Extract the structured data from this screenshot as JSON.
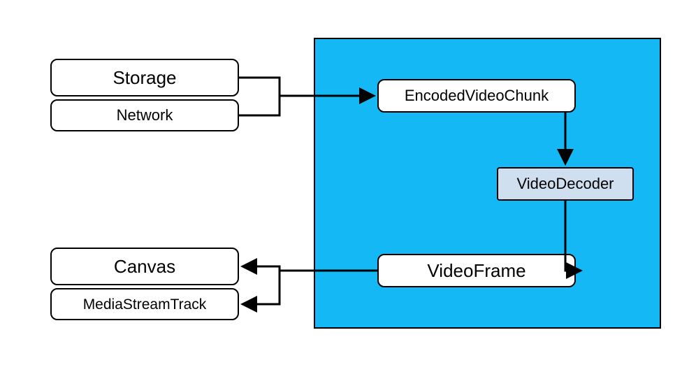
{
  "panel": {
    "color": "#13b8f5"
  },
  "nodes": {
    "storage": {
      "label": "Storage"
    },
    "network": {
      "label": "Network"
    },
    "chunk": {
      "label": "EncodedVideoChunk"
    },
    "decoder": {
      "label": "VideoDecoder"
    },
    "frame": {
      "label": "VideoFrame"
    },
    "canvas": {
      "label": "Canvas"
    },
    "mst": {
      "label": "MediaStreamTrack"
    }
  }
}
